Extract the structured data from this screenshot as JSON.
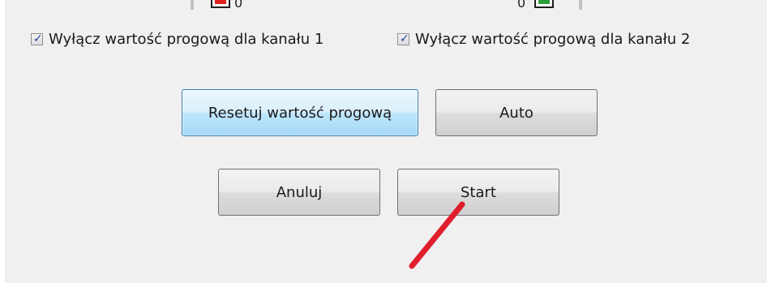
{
  "checkboxes": [
    {
      "label": "Wyłącz wartość progową dla kanału 1",
      "checked": true
    },
    {
      "label": "Wyłącz wartość progową dla kanału 2",
      "checked": true
    }
  ],
  "buttons": {
    "reset_threshold": "Resetuj wartość progową",
    "auto": "Auto",
    "cancel": "Anuluj",
    "start": "Start"
  },
  "channels": {
    "channel1_value": "0",
    "channel2_value": "0"
  },
  "colors": {
    "channel1_swatch": "#e0201c",
    "channel2_swatch": "#2e9e3a",
    "annotation_stroke": "#e01e2c",
    "focused_button_border": "#3c7fb1"
  }
}
